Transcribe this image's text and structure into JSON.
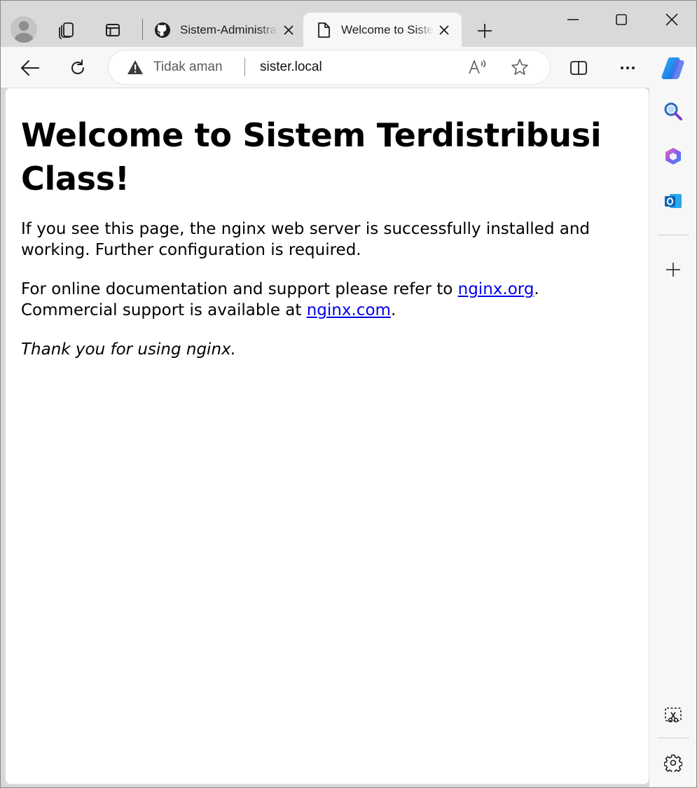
{
  "tabs": [
    {
      "title": "Sistem-Administrasi",
      "icon": "github-icon",
      "active": false
    },
    {
      "title": "Welcome to Sistem Terdistribusi",
      "icon": "page-icon",
      "active": true
    }
  ],
  "address_bar": {
    "security_status": "Tidak aman",
    "url": "sister.local",
    "read_aloud_glyph": "Aᵃ"
  },
  "page": {
    "heading": "Welcome to Sistem Terdistribusi Class!",
    "para1": "If you see this page, the nginx web server is successfully installed and working. Further configuration is required.",
    "para2_before": "For online documentation and support please refer to ",
    "link1": "nginx.org",
    "para2_mid": ".",
    "para2_line2": "Commercial support is available at ",
    "link2": "nginx.com",
    "para2_end": ".",
    "thanks": "Thank you for using nginx."
  },
  "colors": {
    "link": "#0000ee",
    "tab_strip": "#d9d9d9",
    "toolbar": "#f7f7f7",
    "outlook_blue": "#0a64b8",
    "search_accent": "#2b66c4"
  }
}
